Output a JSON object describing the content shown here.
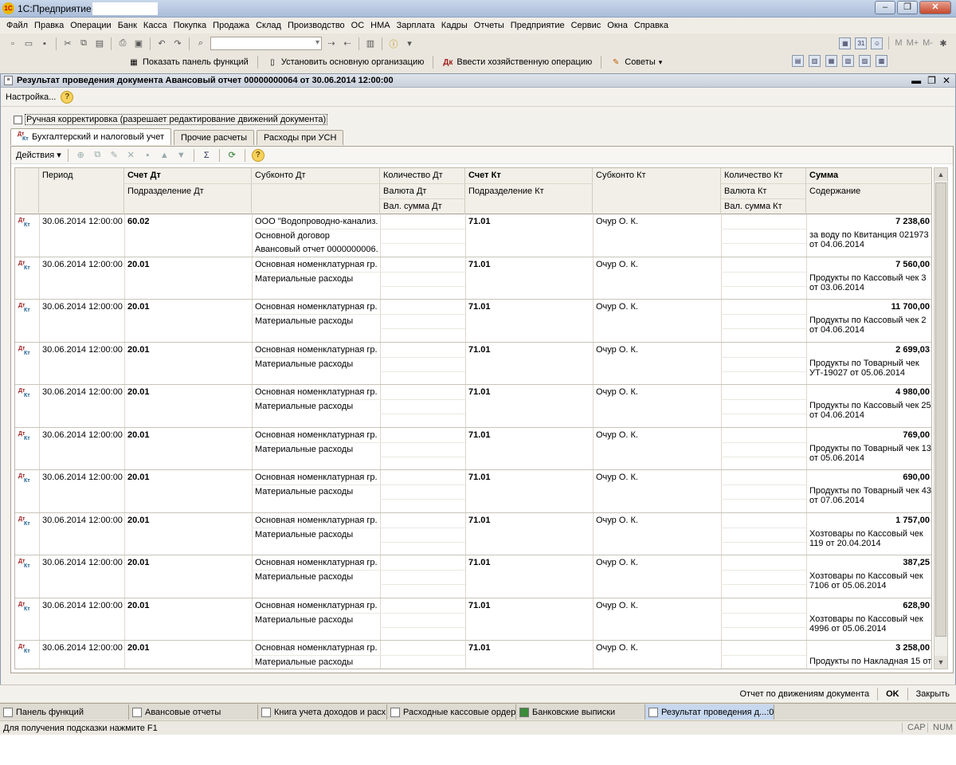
{
  "window": {
    "app_title": "1С:Предприятие -"
  },
  "menu": [
    "Файл",
    "Правка",
    "Операции",
    "Банк",
    "Касса",
    "Покупка",
    "Продажа",
    "Склад",
    "Производство",
    "ОС",
    "НМА",
    "Зарплата",
    "Кадры",
    "Отчеты",
    "Предприятие",
    "Сервис",
    "Окна",
    "Справка"
  ],
  "functions_toolbar": {
    "show_panel": "Показать панель функций",
    "set_org": "Установить основную организацию",
    "enter_operation": "Ввести хозяйственную операцию",
    "tips": "Советы"
  },
  "toolbar_right_labels": [
    "M",
    "M+",
    "M-"
  ],
  "document": {
    "title": "Результат проведения документа Авансовый отчет 00000000064 от 30.06.2014 12:00:00",
    "settings": "Настройка...",
    "manual_correction": "Ручная корректировка (разрешает редактирование движений документа)",
    "tabs": [
      "Бухгалтерский и налоговый учет",
      "Прочие расчеты",
      "Расходы при УСН"
    ],
    "actions_label": "Действия"
  },
  "table": {
    "headers": {
      "period": "Период",
      "acc_dt": "Счет Дт",
      "dept_dt": "Подразделение Дт",
      "subconto_dt": "Субконто Дт",
      "qty_dt": "Количество Дт",
      "cur_dt": "Валюта Дт",
      "cur_sum_dt": "Вал. сумма Дт",
      "acc_kt": "Счет Кт",
      "dept_kt": "Подразделение Кт",
      "subconto_kt": "Субконто Кт",
      "qty_kt": "Количество Кт",
      "cur_kt": "Валюта Кт",
      "cur_sum_kt": "Вал. сумма Кт",
      "sum": "Сумма",
      "content": "Содержание"
    },
    "rows": [
      {
        "period": "30.06.2014 12:00:00",
        "acc_dt": "60.02",
        "dept_dt": "",
        "sub1": "ООО \"Водопроводно-канализ...",
        "sub2": "Основной договор",
        "sub3": "Авансовый отчет 0000000006...",
        "acc_kt": "71.01",
        "sub_kt": "Очур О. К.",
        "sum": "7 238,60",
        "content": "за воду по Квитанция 021973 от 04.06.2014"
      },
      {
        "period": "30.06.2014 12:00:00",
        "acc_dt": "20.01",
        "dept_dt": "",
        "sub1": "Основная номенклатурная гр...",
        "sub2": "Материальные расходы",
        "sub3": "",
        "acc_kt": "71.01",
        "sub_kt": "Очур О. К.",
        "sum": "7 560,00",
        "content": "Продукты по Кассовый чек 3 от 03.06.2014"
      },
      {
        "period": "30.06.2014 12:00:00",
        "acc_dt": "20.01",
        "dept_dt": "",
        "sub1": "Основная номенклатурная гр...",
        "sub2": "Материальные расходы",
        "sub3": "",
        "acc_kt": "71.01",
        "sub_kt": "Очур О. К.",
        "sum": "11 700,00",
        "content": "Продукты по Кассовый чек 2 от 04.06.2014"
      },
      {
        "period": "30.06.2014 12:00:00",
        "acc_dt": "20.01",
        "dept_dt": "",
        "sub1": "Основная номенклатурная гр...",
        "sub2": "Материальные расходы",
        "sub3": "",
        "acc_kt": "71.01",
        "sub_kt": "Очур О. К.",
        "sum": "2 699,03",
        "content": "Продукты по Товарный чек УТ-19027 от 05.06.2014"
      },
      {
        "period": "30.06.2014 12:00:00",
        "acc_dt": "20.01",
        "dept_dt": "",
        "sub1": "Основная номенклатурная гр...",
        "sub2": "Материальные расходы",
        "sub3": "",
        "acc_kt": "71.01",
        "sub_kt": "Очур О. К.",
        "sum": "4 980,00",
        "content": "Продукты по Кассовый чек 25 от 04.06.2014"
      },
      {
        "period": "30.06.2014 12:00:00",
        "acc_dt": "20.01",
        "dept_dt": "",
        "sub1": "Основная номенклатурная гр...",
        "sub2": "Материальные расходы",
        "sub3": "",
        "acc_kt": "71.01",
        "sub_kt": "Очур О. К.",
        "sum": "769,00",
        "content": "Продукты по Товарный чек 13 от 05.06.2014"
      },
      {
        "period": "30.06.2014 12:00:00",
        "acc_dt": "20.01",
        "dept_dt": "",
        "sub1": "Основная номенклатурная гр...",
        "sub2": "Материальные расходы",
        "sub3": "",
        "acc_kt": "71.01",
        "sub_kt": "Очур О. К.",
        "sum": "690,00",
        "content": "Продукты по Товарный чек 43 от 07.06.2014"
      },
      {
        "period": "30.06.2014 12:00:00",
        "acc_dt": "20.01",
        "dept_dt": "",
        "sub1": "Основная номенклатурная гр...",
        "sub2": "Материальные расходы",
        "sub3": "",
        "acc_kt": "71.01",
        "sub_kt": "Очур О. К.",
        "sum": "1 757,00",
        "content": "Хозтовары по Кассовый чек 119 от 20.04.2014"
      },
      {
        "period": "30.06.2014 12:00:00",
        "acc_dt": "20.01",
        "dept_dt": "",
        "sub1": "Основная номенклатурная гр...",
        "sub2": "Материальные расходы",
        "sub3": "",
        "acc_kt": "71.01",
        "sub_kt": "Очур О. К.",
        "sum": "387,25",
        "content": "Хозтовары по Кассовый чек 7106 от 05.06.2014"
      },
      {
        "period": "30.06.2014 12:00:00",
        "acc_dt": "20.01",
        "dept_dt": "",
        "sub1": "Основная номенклатурная гр...",
        "sub2": "Материальные расходы",
        "sub3": "",
        "acc_kt": "71.01",
        "sub_kt": "Очур О. К.",
        "sum": "628,90",
        "content": "Хозтовары по Кассовый чек 4996 от 05.06.2014"
      },
      {
        "period": "30.06.2014 12:00:00",
        "acc_dt": "20.01",
        "dept_dt": "",
        "sub1": "Основная номенклатурная гр...",
        "sub2": "Материальные расходы",
        "sub3": "",
        "acc_kt": "71.01",
        "sub_kt": "Очур О. К.",
        "sum": "3 258,00",
        "content": "Продукты по Накладная 15 от"
      }
    ]
  },
  "bottom_bar": {
    "report": "Отчет по движениям документа",
    "ok": "OK",
    "close": "Закрыть"
  },
  "taskbar": [
    "Панель функций",
    "Авансовые отчеты",
    "Книга учета доходов и расх...",
    "Расходные кассовые ордера",
    "Банковские выписки",
    "Результат проведения д...:00"
  ],
  "statusbar": {
    "hint": "Для получения подсказки нажмите F1",
    "cap": "CAP",
    "num": "NUM"
  }
}
